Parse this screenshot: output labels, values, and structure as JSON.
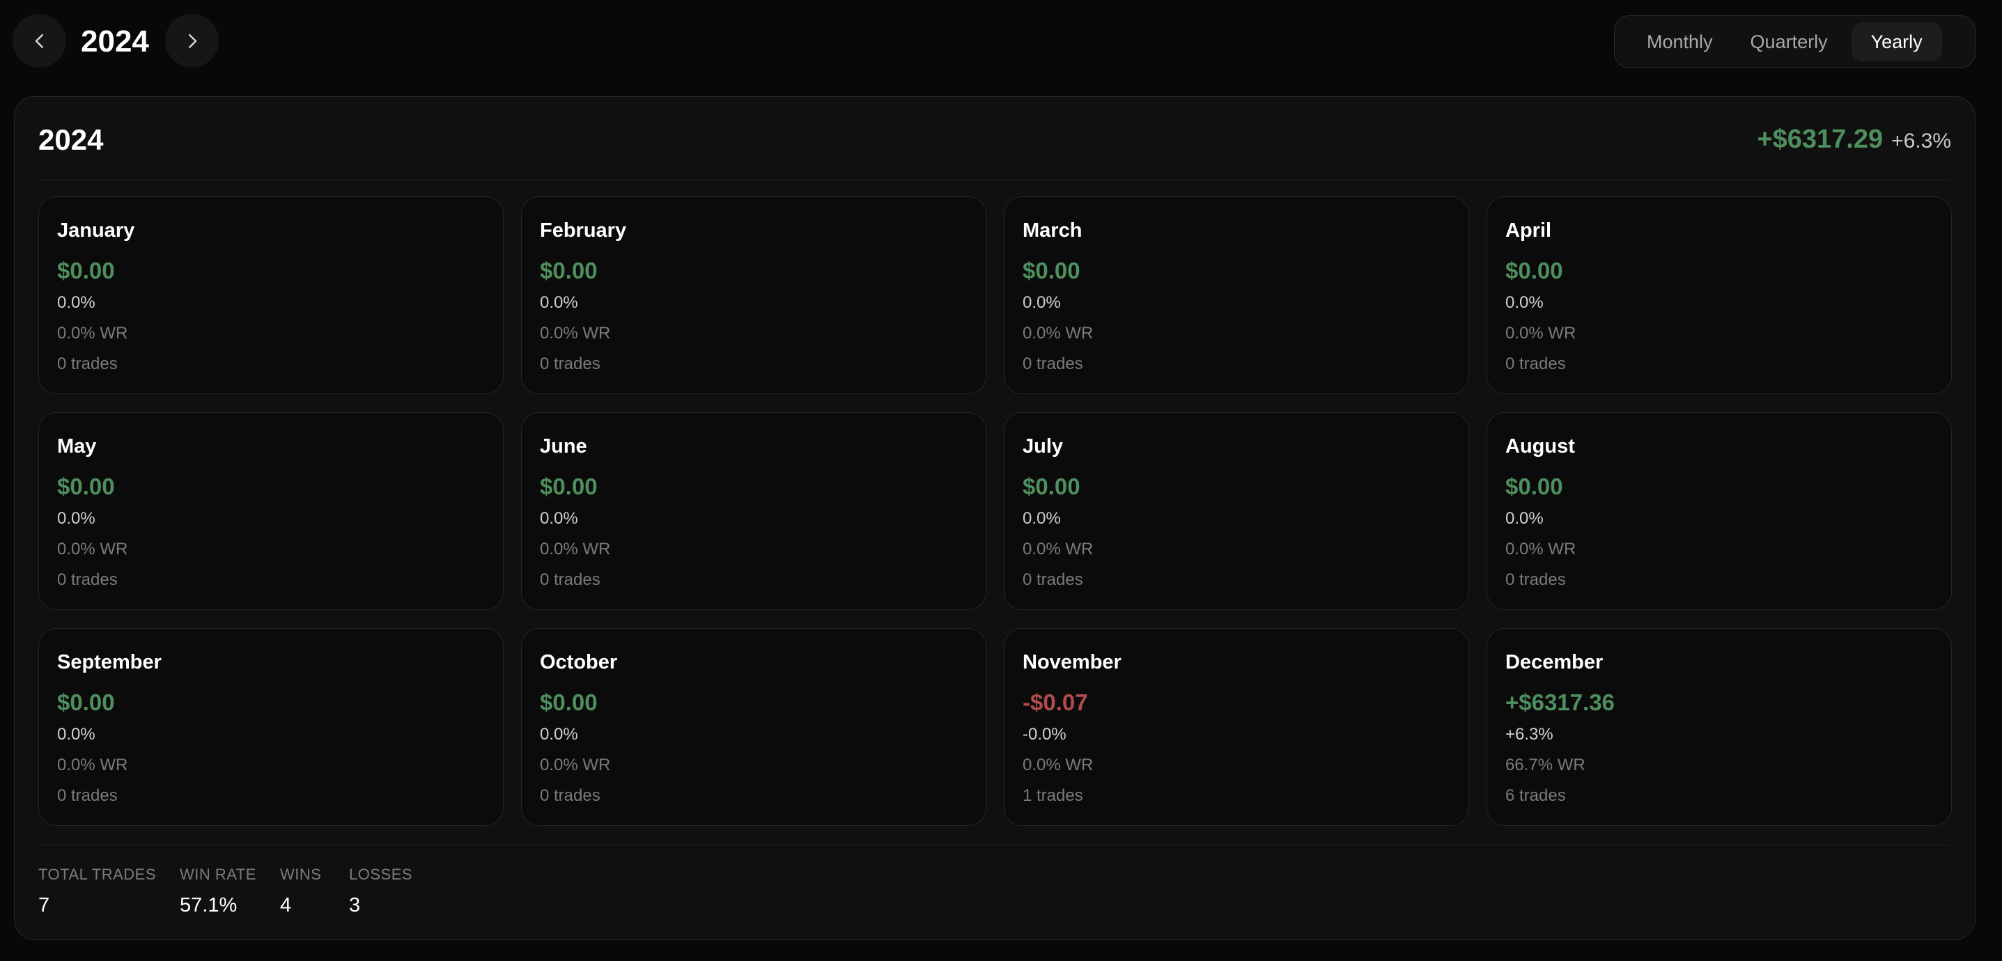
{
  "header": {
    "year": "2024",
    "prev_icon": "chevron-left-icon",
    "next_icon": "chevron-right-icon",
    "period_options": [
      "Monthly",
      "Quarterly",
      "Yearly"
    ],
    "selected_period": "Yearly"
  },
  "panel": {
    "year": "2024",
    "total_pnl": "+$6317.29",
    "total_pct": "+6.3%"
  },
  "months": [
    {
      "name": "January",
      "pnl": "$0.00",
      "pct": "0.0%",
      "wr": "0.0% WR",
      "trades": "0 trades"
    },
    {
      "name": "February",
      "pnl": "$0.00",
      "pct": "0.0%",
      "wr": "0.0% WR",
      "trades": "0 trades"
    },
    {
      "name": "March",
      "pnl": "$0.00",
      "pct": "0.0%",
      "wr": "0.0% WR",
      "trades": "0 trades"
    },
    {
      "name": "April",
      "pnl": "$0.00",
      "pct": "0.0%",
      "wr": "0.0% WR",
      "trades": "0 trades"
    },
    {
      "name": "May",
      "pnl": "$0.00",
      "pct": "0.0%",
      "wr": "0.0% WR",
      "trades": "0 trades"
    },
    {
      "name": "June",
      "pnl": "$0.00",
      "pct": "0.0%",
      "wr": "0.0% WR",
      "trades": "0 trades"
    },
    {
      "name": "July",
      "pnl": "$0.00",
      "pct": "0.0%",
      "wr": "0.0% WR",
      "trades": "0 trades"
    },
    {
      "name": "August",
      "pnl": "$0.00",
      "pct": "0.0%",
      "wr": "0.0% WR",
      "trades": "0 trades"
    },
    {
      "name": "September",
      "pnl": "$0.00",
      "pct": "0.0%",
      "wr": "0.0% WR",
      "trades": "0 trades"
    },
    {
      "name": "October",
      "pnl": "$0.00",
      "pct": "0.0%",
      "wr": "0.0% WR",
      "trades": "0 trades"
    },
    {
      "name": "November",
      "pnl": "-$0.07",
      "pct": "-0.0%",
      "wr": "0.0% WR",
      "trades": "1 trades"
    },
    {
      "name": "December",
      "pnl": "+$6317.36",
      "pct": "+6.3%",
      "wr": "66.7% WR",
      "trades": "6 trades"
    }
  ],
  "stats": {
    "total_trades_label": "TOTAL TRADES",
    "total_trades": "7",
    "win_rate_label": "WIN RATE",
    "win_rate": "57.1%",
    "wins_label": "WINS",
    "wins": "4",
    "losses_label": "LOSSES",
    "losses": "3"
  },
  "colors": {
    "positive": "#4e8f5e",
    "negative": "#b04c4c",
    "background": "#080808"
  }
}
